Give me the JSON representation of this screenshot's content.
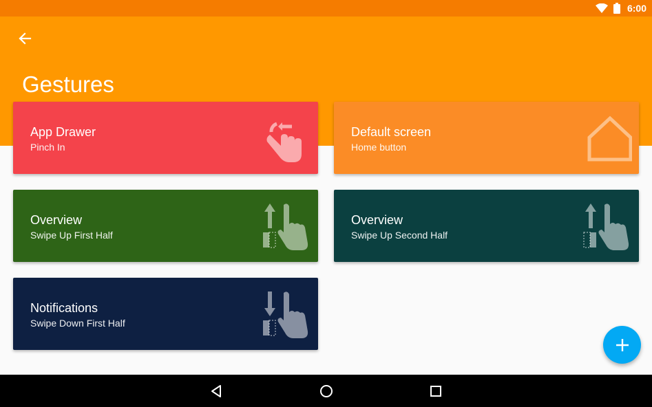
{
  "status_bar": {
    "time": "6:00",
    "color": "#f57c00",
    "icons": [
      "wifi-icon",
      "battery-icon"
    ]
  },
  "app_bar": {
    "title": "Gestures",
    "color": "#ff9800",
    "back_icon": "arrow-back-icon"
  },
  "gestures": [
    {
      "title": "App Drawer",
      "subtitle": "Pinch In",
      "color": "#f4434b",
      "icon": "pinch-in-icon"
    },
    {
      "title": "Default screen",
      "subtitle": "Home button",
      "color": "#fb8c26",
      "icon": "home-icon"
    },
    {
      "title": "Overview",
      "subtitle": "Swipe Up First Half",
      "color": "#2e6417",
      "icon": "swipe-up-first-half-icon"
    },
    {
      "title": "Overview",
      "subtitle": "Swipe Up Second Half",
      "color": "#0b4040",
      "icon": "swipe-up-second-half-icon"
    },
    {
      "title": "Notifications",
      "subtitle": "Swipe Down First Half",
      "color": "#0e2042",
      "icon": "swipe-down-first-half-icon"
    }
  ],
  "fab": {
    "icon": "add-icon",
    "color": "#03a9f4"
  },
  "nav_bar": {
    "buttons": [
      "back-nav-icon",
      "home-nav-icon",
      "recents-nav-icon"
    ]
  }
}
